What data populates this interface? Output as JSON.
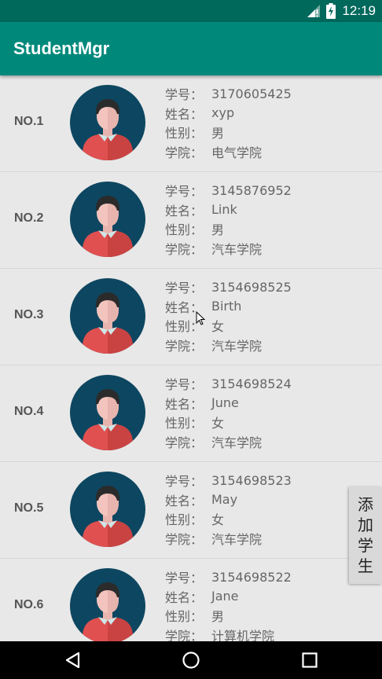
{
  "status_bar": {
    "time": "12:19",
    "icons": [
      "signal-icon",
      "battery-charging-icon"
    ]
  },
  "app": {
    "title": "StudentMgr"
  },
  "labels": {
    "id": "学号：",
    "name": "姓名：",
    "gender": "性别：",
    "college": "学院："
  },
  "students": [
    {
      "no": "NO.1",
      "id": "3170605425",
      "name": "xyp",
      "gender": "男",
      "college": "电气学院"
    },
    {
      "no": "NO.2",
      "id": "3145876952",
      "name": "Link",
      "gender": "男",
      "college": "汽车学院"
    },
    {
      "no": "NO.3",
      "id": "3154698525",
      "name": "Birth",
      "gender": "女",
      "college": "汽车学院"
    },
    {
      "no": "NO.4",
      "id": "3154698524",
      "name": "June",
      "gender": "女",
      "college": "汽车学院"
    },
    {
      "no": "NO.5",
      "id": "3154698523",
      "name": "May",
      "gender": "女",
      "college": "汽车学院"
    },
    {
      "no": "NO.6",
      "id": "3154698522",
      "name": "Jane",
      "gender": "男",
      "college": "计算机学院"
    }
  ],
  "add_button": {
    "chars": [
      "添",
      "加",
      "学",
      "生"
    ]
  },
  "nav": {
    "icons": [
      "back-icon",
      "home-icon",
      "recents-icon"
    ]
  },
  "colors": {
    "status_bar": "#00695c",
    "app_bar": "#00897b",
    "background": "#e8e8e8",
    "avatar_bg": "#0d4660",
    "shirt": "#e05050"
  }
}
